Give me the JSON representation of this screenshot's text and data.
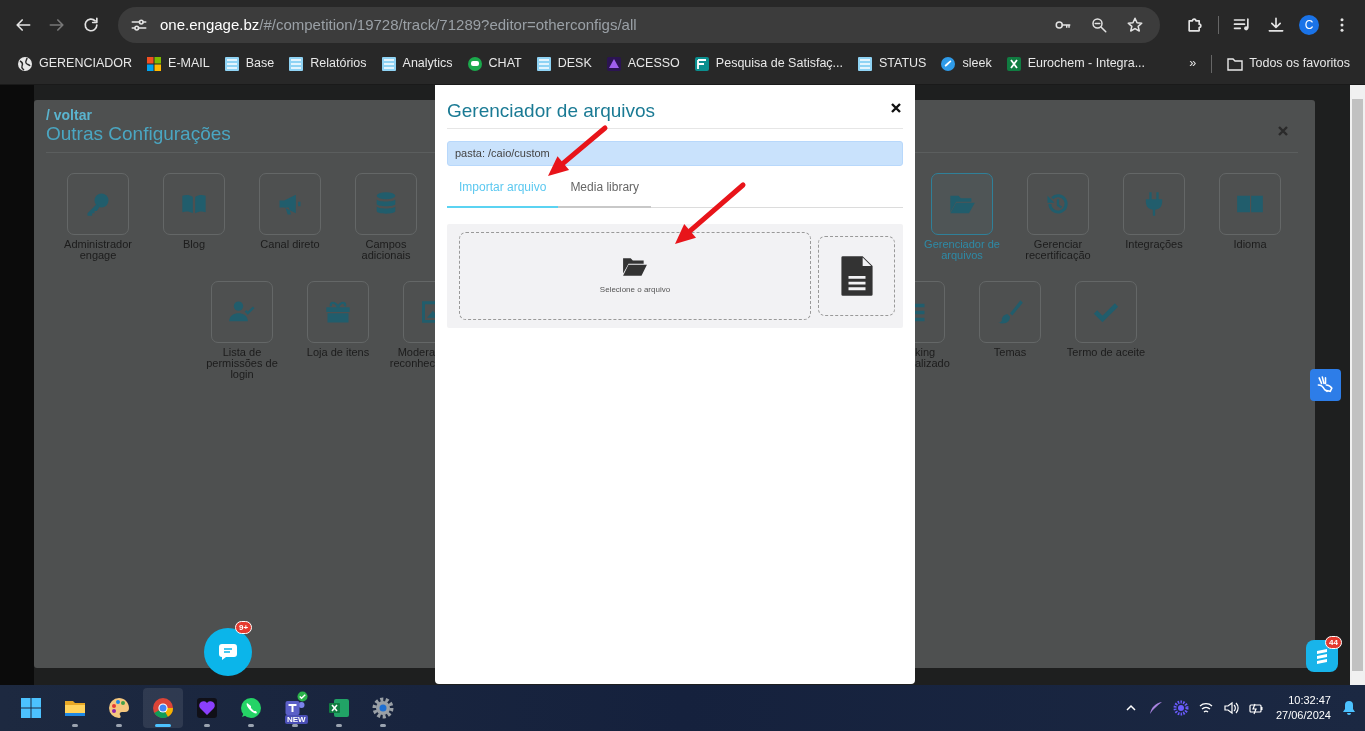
{
  "browser": {
    "nav": [
      {
        "kind": "back",
        "disabled": false
      },
      {
        "kind": "forward",
        "disabled": true
      },
      {
        "kind": "reload",
        "disabled": false
      }
    ],
    "url_host": "one.engage.bz",
    "url_path": "/#/competition/19728/track/71289?editor=otherconfigs/all",
    "profile_initial": "C"
  },
  "bookmarks": [
    {
      "label": "GERENCIADOR",
      "kind": "globe"
    },
    {
      "label": "E-MAIL",
      "kind": "windows"
    },
    {
      "label": "Base",
      "kind": "stack"
    },
    {
      "label": "Relatórios",
      "kind": "stack"
    },
    {
      "label": "Analytics",
      "kind": "stack"
    },
    {
      "label": "CHAT",
      "kind": "chat"
    },
    {
      "label": "DESK",
      "kind": "stack"
    },
    {
      "label": "ACESSO",
      "kind": "acesso"
    },
    {
      "label": "Pesquisa de Satisfaç...",
      "kind": "forms"
    },
    {
      "label": "STATUS",
      "kind": "stack"
    },
    {
      "label": "sleek",
      "kind": "sleek"
    },
    {
      "label": "Eurochem - Integra...",
      "kind": "excel"
    }
  ],
  "bookmarks_overflow": "»",
  "all_bookmarks": "Todos os favoritos",
  "page": {
    "back_link": "/ voltar",
    "title": "Outras Configurações",
    "rows": [
      {
        "left": [
          {
            "label": "Administrador engage",
            "selected": false
          },
          {
            "label": "Blog",
            "selected": false
          },
          {
            "label": "Canal direto",
            "selected": false
          },
          {
            "label": "Campos adicionais",
            "selected": false
          }
        ],
        "right": [
          {
            "label": "Gerenciador de arquivos",
            "selected": true
          },
          {
            "label": "Gerenciar recertificação",
            "selected": false
          },
          {
            "label": "Integrações",
            "selected": false
          },
          {
            "label": "Idioma",
            "selected": false
          }
        ]
      },
      {
        "left": [
          {
            "label": "Lista de permissões de login",
            "selected": false
          },
          {
            "label": "Loja de itens",
            "selected": false
          },
          {
            "label": "Modera\nreconhec",
            "selected": false
          }
        ],
        "right": [
          {
            "label": "king\nalizado",
            "selected": false
          },
          {
            "label": "Temas",
            "selected": false
          },
          {
            "label": "Termo de aceite",
            "selected": false
          }
        ]
      }
    ]
  },
  "modal": {
    "title": "Gerenciador de arquivos",
    "folder_label": "pasta: /caio/custom",
    "tabs": [
      {
        "label": "Importar arquivo",
        "selected": true
      },
      {
        "label": "Media library",
        "selected": false
      }
    ],
    "dropzone_label": "Selecione o arquivo",
    "arrows": [
      {
        "kind": "arrow"
      },
      {
        "kind": "arrow"
      }
    ]
  },
  "chat_badge": "9+",
  "widget_badge": "44",
  "taskbar": {
    "items": [
      {
        "kind": "start",
        "running": false,
        "active": false
      },
      {
        "kind": "explorer",
        "running": true,
        "active": false
      },
      {
        "kind": "paint",
        "running": true,
        "active": false
      },
      {
        "kind": "chrome",
        "running": true,
        "active": true
      },
      {
        "kind": "heart",
        "running": true,
        "active": false
      },
      {
        "kind": "whatsapp",
        "running": true,
        "active": false
      },
      {
        "kind": "teams",
        "running": true,
        "active": false,
        "badge": "NEW"
      },
      {
        "kind": "excel",
        "running": true,
        "active": false
      },
      {
        "kind": "settings",
        "running": true,
        "active": false
      }
    ],
    "time": "10:32:47",
    "date": "27/06/2024"
  }
}
